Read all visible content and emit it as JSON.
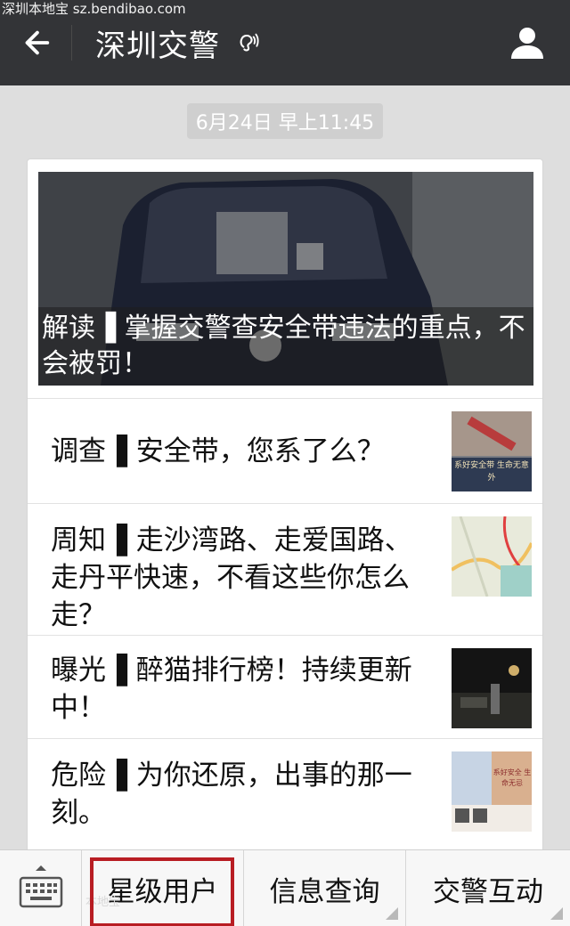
{
  "watermark": "深圳本地宝 sz.bendibao.com",
  "header": {
    "title": "深圳交警"
  },
  "timestamp": "6月24日 早上11:45",
  "hero": {
    "caption": "解读▐ 掌握交警查安全带违法的重点，不会被罚！"
  },
  "articles": [
    {
      "text": "调查▐ 安全带，您系了么？",
      "thumb_caption": "系好安全带 生命无意外"
    },
    {
      "text": "周知▐ 走沙湾路、走爱国路、走丹平快速，不看这些你怎么走？"
    },
    {
      "text": "曝光▐ 醉猫排行榜！持续更新中！"
    },
    {
      "text": "危险▐ 为你还原，出事的那一刻。",
      "thumb_caption": "系好安全 生命无忌"
    }
  ],
  "bottom_menu": {
    "items": [
      "星级用户",
      "信息查询",
      "交警互动"
    ],
    "watermark": "本地宝"
  },
  "colors": {
    "topbar": "#333437",
    "highlight": "#b81d23",
    "background": "#dedede"
  }
}
